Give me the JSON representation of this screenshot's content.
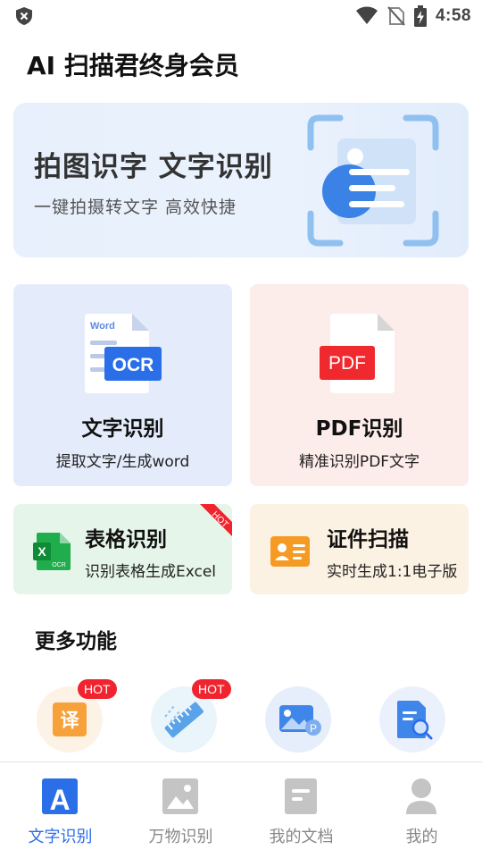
{
  "status_bar": {
    "time": "4:58",
    "icons": [
      "shield-icon",
      "wifi-icon",
      "no-sim-icon",
      "battery-charging-icon"
    ]
  },
  "page": {
    "title": "AI 扫描君终身会员"
  },
  "banner": {
    "title": "拍图识字  文字识别",
    "subtitle": "一键拍摄转文字  高效快捷"
  },
  "cards": {
    "ocr": {
      "title": "文字识别",
      "subtitle": "提取文字/生成word",
      "icon_word_label": "Word",
      "icon_badge": "OCR"
    },
    "pdf": {
      "title": "PDF识别",
      "subtitle": "精准识别PDF文字",
      "icon_badge": "PDF"
    },
    "table": {
      "title": "表格识别",
      "subtitle": "识别表格生成Excel",
      "ribbon": "HOT",
      "icon_letter": "X",
      "icon_tag": "OCR"
    },
    "id": {
      "title": "证件扫描",
      "subtitle": "实时生成1:1电子版"
    }
  },
  "more": {
    "title": "更多功能",
    "items": [
      {
        "icon": "translate-icon",
        "badge": "HOT",
        "glyph": "译"
      },
      {
        "icon": "ruler-measure-icon",
        "badge": "HOT"
      },
      {
        "icon": "image-edit-icon",
        "glyph": "P"
      },
      {
        "icon": "document-search-icon"
      }
    ]
  },
  "bottom_nav": {
    "items": [
      {
        "label": "文字识别",
        "active": true,
        "glyph": "A"
      },
      {
        "label": "万物识别",
        "active": false
      },
      {
        "label": "我的文档",
        "active": false
      },
      {
        "label": "我的",
        "active": false
      }
    ]
  },
  "colors": {
    "accent": "#2b6fe8",
    "hot": "#f0242f",
    "pdf_red": "#f0292f",
    "excel_green": "#1fae4b",
    "id_orange": "#f59a23"
  }
}
